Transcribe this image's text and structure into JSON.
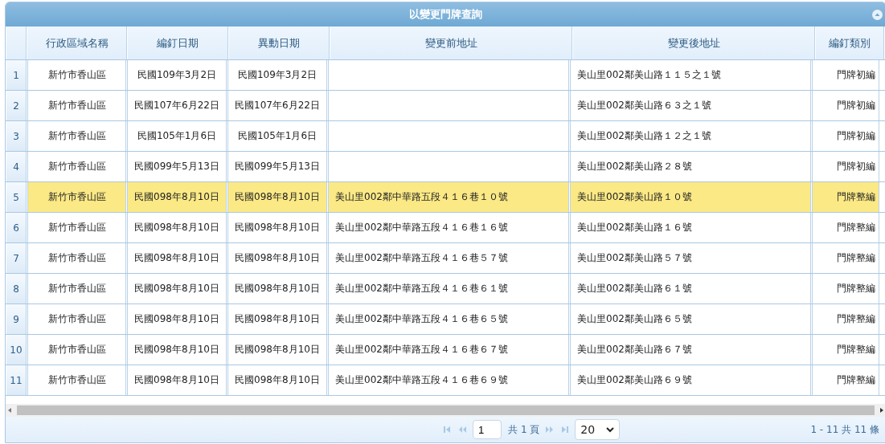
{
  "panel": {
    "title": "以變更門牌查詢"
  },
  "table": {
    "columns": [
      "行政區域名稱",
      "編釘日期",
      "異動日期",
      "變更前地址",
      "變更後地址",
      "編釘類別"
    ],
    "rows": [
      {
        "number": "1",
        "selected": false,
        "cells": [
          "新竹市香山區",
          "民國109年3月2日",
          "民國109年3月2日",
          "",
          "美山里002鄰美山路１１５之１號",
          "門牌初編"
        ]
      },
      {
        "number": "2",
        "selected": false,
        "cells": [
          "新竹市香山區",
          "民國107年6月22日",
          "民國107年6月22日",
          "",
          "美山里002鄰美山路６３之１號",
          "門牌初編"
        ]
      },
      {
        "number": "3",
        "selected": false,
        "cells": [
          "新竹市香山區",
          "民國105年1月6日",
          "民國105年1月6日",
          "",
          "美山里002鄰美山路１２之１號",
          "門牌初編"
        ]
      },
      {
        "number": "4",
        "selected": false,
        "cells": [
          "新竹市香山區",
          "民國099年5月13日",
          "民國099年5月13日",
          "",
          "美山里002鄰美山路２８號",
          "門牌初編"
        ]
      },
      {
        "number": "5",
        "selected": true,
        "cells": [
          "新竹市香山區",
          "民國098年8月10日",
          "民國098年8月10日",
          "美山里002鄰中華路五段４１６巷１０號",
          "美山里002鄰美山路１０號",
          "門牌整編"
        ]
      },
      {
        "number": "6",
        "selected": false,
        "cells": [
          "新竹市香山區",
          "民國098年8月10日",
          "民國098年8月10日",
          "美山里002鄰中華路五段４１６巷１６號",
          "美山里002鄰美山路１６號",
          "門牌整編"
        ]
      },
      {
        "number": "7",
        "selected": false,
        "cells": [
          "新竹市香山區",
          "民國098年8月10日",
          "民國098年8月10日",
          "美山里002鄰中華路五段４１６巷５７號",
          "美山里002鄰美山路５７號",
          "門牌整編"
        ]
      },
      {
        "number": "8",
        "selected": false,
        "cells": [
          "新竹市香山區",
          "民國098年8月10日",
          "民國098年8月10日",
          "美山里002鄰中華路五段４１６巷６１號",
          "美山里002鄰美山路６１號",
          "門牌整編"
        ]
      },
      {
        "number": "9",
        "selected": false,
        "cells": [
          "新竹市香山區",
          "民國098年8月10日",
          "民國098年8月10日",
          "美山里002鄰中華路五段４１６巷６５號",
          "美山里002鄰美山路６５號",
          "門牌整編"
        ]
      },
      {
        "number": "10",
        "selected": false,
        "cells": [
          "新竹市香山區",
          "民國098年8月10日",
          "民國098年8月10日",
          "美山里002鄰中華路五段４１６巷６７號",
          "美山里002鄰美山路６７號",
          "門牌整編"
        ]
      },
      {
        "number": "11",
        "selected": false,
        "cells": [
          "新竹市香山區",
          "民國098年8月10日",
          "民國098年8月10日",
          "美山里002鄰中華路五段４１６巷６９號",
          "美山里002鄰美山路６９號",
          "門牌整編"
        ]
      }
    ]
  },
  "pager": {
    "page": "1",
    "page_total": "共 1 頁",
    "page_size": "20",
    "summary": "1 - 11 共 11 條"
  }
}
